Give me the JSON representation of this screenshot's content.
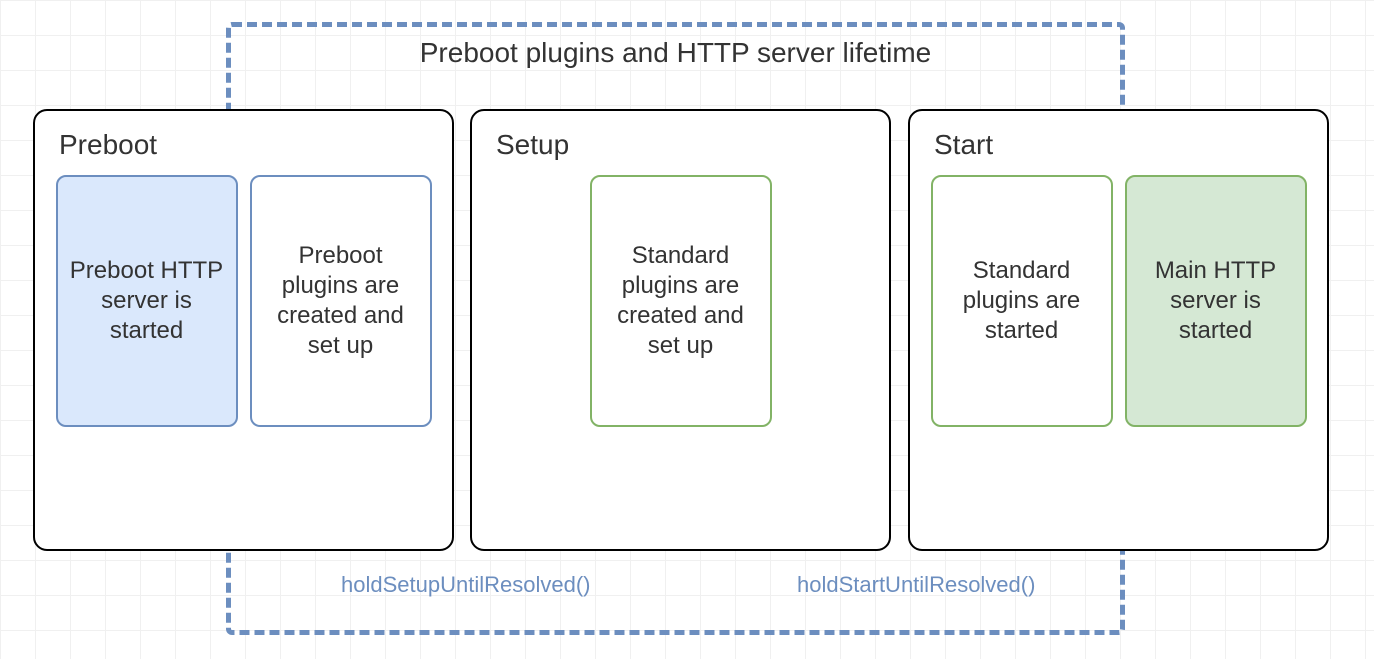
{
  "lifetime_title": "Preboot plugins and HTTP server lifetime",
  "phases": {
    "preboot": {
      "title": "Preboot",
      "box1": "Preboot HTTP server is started",
      "box2": "Preboot plugins are created and set up"
    },
    "setup": {
      "title": "Setup",
      "box1": "Standard plugins are created and set up"
    },
    "start": {
      "title": "Start",
      "box1": "Standard plugins are started",
      "box2": "Main HTTP server is started"
    }
  },
  "hold_labels": {
    "setup": "holdSetupUntilResolved()",
    "start": "holdStartUntilResolved()"
  }
}
